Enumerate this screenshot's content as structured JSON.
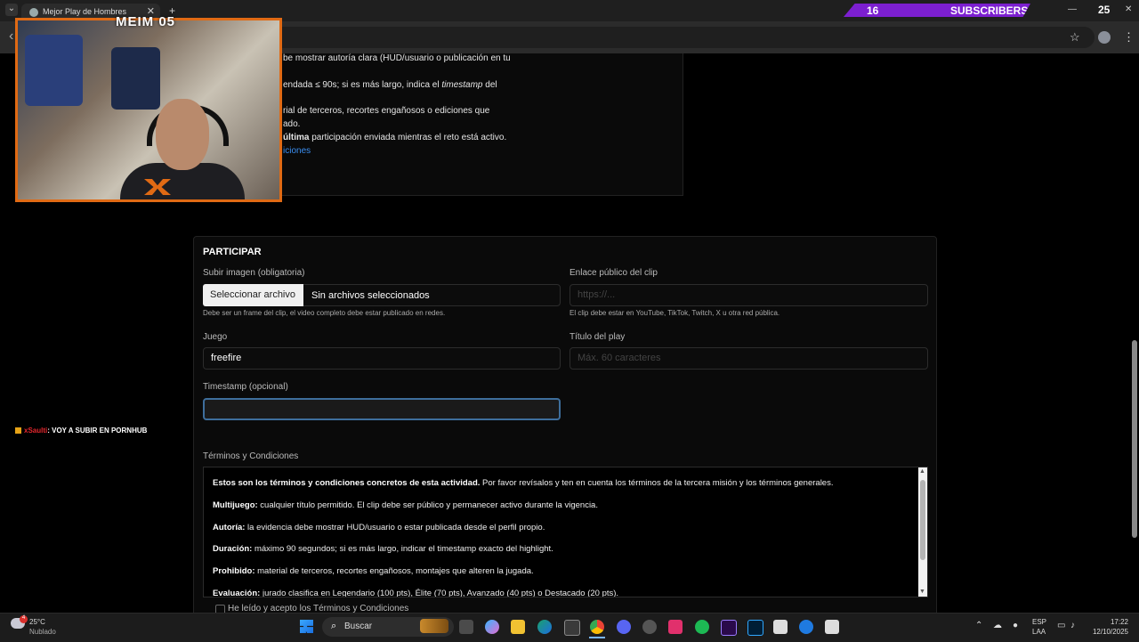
{
  "browser": {
    "tab_title": "Mejor Play de Hombres",
    "tab_close": "✕",
    "new_tab": "+",
    "tab_search": "⌄",
    "star": "☆",
    "menu": "⋮",
    "back": "‹"
  },
  "overlay": {
    "subscribers_count": "16",
    "subscribers_label": "SUBSCRIBERS",
    "timer": "25",
    "stream_title": "MEIM 05"
  },
  "rules_card": {
    "line1": "be mostrar autoría clara (HUD/usuario o publicación en tu",
    "line2_a": "endada ≤ 90s; si es más largo, indica el ",
    "line2_b": "timestamp",
    "line2_c": " del",
    "line3": "rial de terceros, recortes engañosos o ediciones que",
    "line4": "ado.",
    "line5_a": "ú",
    "line5_b": "ltima",
    "line5_c": " participación enviada mientras el reto está activo.",
    "line6": "iciones"
  },
  "chat": {
    "user": "xSaulti",
    "message": ": VOY A SUBIR EN PORNHUB"
  },
  "form": {
    "heading": "PARTICIPAR",
    "image_label": "Subir imagen (obligatoria)",
    "file_button": "Seleccionar archivo",
    "file_status": "Sin archivos seleccionados",
    "image_help": "Debe ser un frame del clip, el video completo debe estar publicado en redes.",
    "link_label": "Enlace público del clip",
    "link_placeholder": "https://...",
    "link_help": "El clip debe estar en YouTube, TikTok, Twitch, X u otra red pública.",
    "game_label": "Juego",
    "game_value": "freefire",
    "title_label": "Título del play",
    "title_placeholder": "Máx. 60 caracteres",
    "timestamp_label": "Timestamp (opcional)",
    "timestamp_placeholder": "",
    "terms_label": "Términos y Condiciones",
    "terms": [
      {
        "bold": "Estos son los términos y condiciones concretos de esta actividad.",
        "text": " Por favor revísalos y ten en cuenta los términos de la tercera misión y los términos generales."
      },
      {
        "bold": "Multijuego:",
        "text": " cualquier título permitido. El clip debe ser público y permanecer activo durante la vigencia."
      },
      {
        "bold": "Autoría:",
        "text": " la evidencia debe mostrar HUD/usuario o estar publicada desde el perfil propio."
      },
      {
        "bold": "Duración:",
        "text": " máximo 90 segundos; si es más largo, indicar el timestamp exacto del highlight."
      },
      {
        "bold": "Prohibido:",
        "text": " material de terceros, recortes engañosos, montajes que alteren la jugada."
      },
      {
        "bold": "Evaluación:",
        "text": " jurado clasifica en Legendario (100 pts), Élite (70 pts), Avanzado (40 pts) o Destacado (20 pts)."
      }
    ],
    "accept_label": "He leído y acepto los Términos y Condiciones"
  },
  "taskbar": {
    "temp": "25°C",
    "weather": "Nublado",
    "search_label": "Buscar",
    "lang1": "ESP",
    "lang2": "LAA",
    "time": "17:22",
    "date": "12/10/2025",
    "notif_count": "4"
  },
  "colors": {
    "accent_link": "#3b8ef0",
    "sub_bar": "#7c1fd0",
    "cam_border": "#e06a14"
  }
}
